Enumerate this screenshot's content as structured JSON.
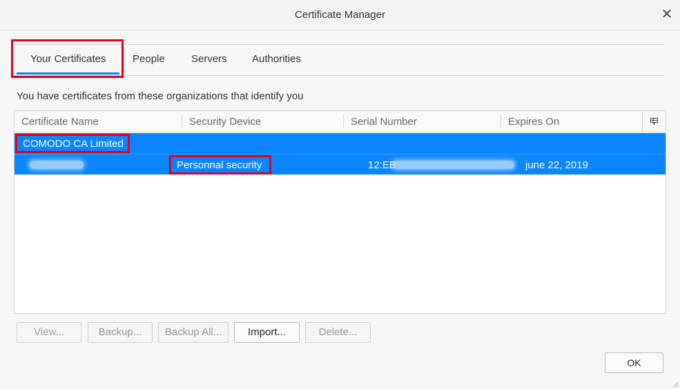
{
  "window": {
    "title": "Certificate Manager",
    "close_icon": "close-icon"
  },
  "tabs": [
    {
      "label": "Your Certificates",
      "selected": true
    },
    {
      "label": "People",
      "selected": false
    },
    {
      "label": "Servers",
      "selected": false
    },
    {
      "label": "Authorities",
      "selected": false
    }
  ],
  "description": "You have certificates from these organizations that identify you",
  "table": {
    "columns": [
      "Certificate Name",
      "Security Device",
      "Serial Number",
      "Expires On"
    ],
    "column_picker_icon": "column-picker-icon",
    "groups": [
      {
        "name": "COMODO CA Limited",
        "certificates": [
          {
            "name_redacted": true,
            "security_device": "Personnal security",
            "serial_number_prefix": "12:EE",
            "serial_redacted": true,
            "expires_on": "june 22, 2019"
          }
        ]
      }
    ]
  },
  "buttons": {
    "view": "View...",
    "backup": "Backup...",
    "backup_all": "Backup All...",
    "import": "Import...",
    "delete": "Delete...",
    "ok": "OK"
  },
  "colors": {
    "selection": "#0a84ff",
    "highlight_box": "#e0001a",
    "tab_underline": "#0a84ff"
  }
}
